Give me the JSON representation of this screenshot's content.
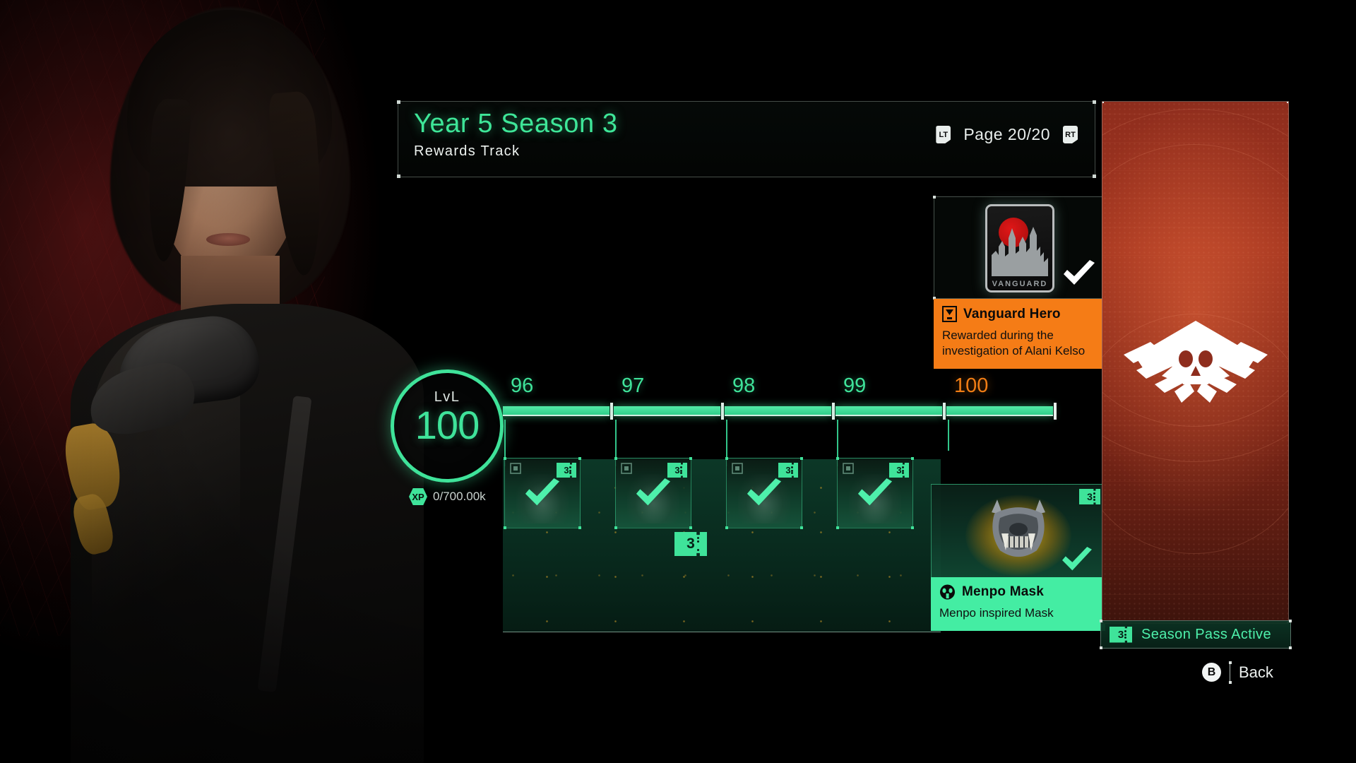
{
  "header": {
    "season_title": "Year 5 Season 3",
    "subtitle": "Rewards Track",
    "page_label": "Page 20/20",
    "prev_button": "LT",
    "next_button": "RT"
  },
  "player": {
    "level_label": "LvL",
    "level_value": "100",
    "xp_badge": "XP",
    "xp_text": "0/700.00k"
  },
  "track": {
    "levels": [
      {
        "number": "96",
        "current": false
      },
      {
        "number": "97",
        "current": false
      },
      {
        "number": "98",
        "current": false
      },
      {
        "number": "99",
        "current": false
      },
      {
        "number": "100",
        "current": true
      }
    ],
    "tiles": [
      {
        "claimed": true,
        "ticket": "3",
        "category_icon": "backpack-icon"
      },
      {
        "claimed": true,
        "ticket": "3",
        "category_icon": "crate-icon"
      },
      {
        "claimed": true,
        "ticket": "3",
        "category_icon": "container-icon"
      },
      {
        "claimed": true,
        "ticket": "3",
        "category_icon": "outfit-icon"
      }
    ],
    "panel_ticket": "3"
  },
  "vanguard_reward": {
    "art_label": "VANGUARD",
    "title": "Vanguard Hero",
    "description": "Rewarded during the investigation of Alani Kelso",
    "claimed": true,
    "accent_color": "#f57c16",
    "icon": "emblem-icon"
  },
  "menpo_reward": {
    "title": "Menpo Mask",
    "description": "Menpo inspired Mask",
    "ticket": "3",
    "claimed": true,
    "accent_color": "#44eda3",
    "icon": "mask-icon"
  },
  "season_pass": {
    "banner_text": "Season Pass Active",
    "banner_ticket": "3",
    "emblem": "skull-knives-emblem"
  },
  "footer": {
    "back_button": "B",
    "back_label": "Back"
  },
  "colors": {
    "accent_green": "#3fe39a",
    "accent_orange": "#f57c16",
    "panel_red": "#a3351f"
  }
}
